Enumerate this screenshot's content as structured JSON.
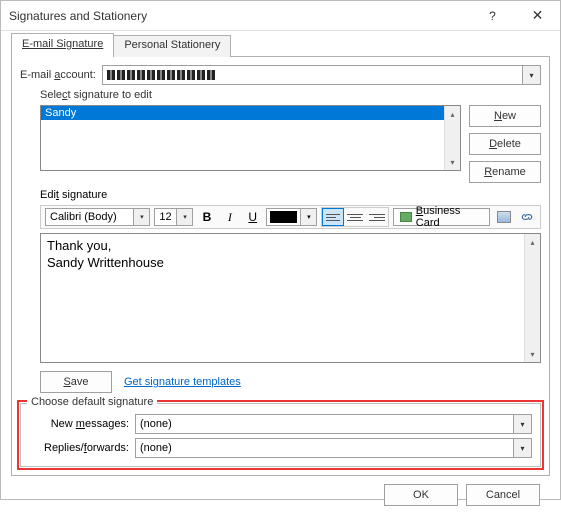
{
  "window": {
    "title": "Signatures and Stationery",
    "help_symbol": "?",
    "close_symbol": "✕"
  },
  "tabs": {
    "email": "E-mail Signature",
    "personal": "Personal Stationery"
  },
  "account": {
    "label_pre": "E-mail ",
    "label_key": "a",
    "label_post": "ccount:",
    "value": ""
  },
  "select_sig": {
    "label_pre": "Sele",
    "label_key": "c",
    "label_post": "t signature to edit",
    "selected": "Sandy"
  },
  "buttons": {
    "new_key": "N",
    "new_post": "ew",
    "delete_key": "D",
    "delete_post": "elete",
    "rename_key": "R",
    "rename_post": "ename",
    "save_key": "S",
    "save_post": "ave"
  },
  "edit": {
    "label_pre": "Edi",
    "label_key": "t",
    "label_post": " signature",
    "font": "Calibri (Body)",
    "size": "12",
    "content": "Thank you,\nSandy Writtenhouse"
  },
  "toolbar": {
    "bold": "B",
    "italic": "I",
    "underline": "U",
    "biz_key": "B",
    "biz_post": "usiness Card"
  },
  "templates_link": "Get signature templates",
  "defaults": {
    "legend": "Choose default signature",
    "newmsg_pre": "New ",
    "newmsg_key": "m",
    "newmsg_post": "essages:",
    "newmsg_value": "(none)",
    "replies_pre": "Replies/",
    "replies_key": "f",
    "replies_post": "orwards:",
    "replies_value": "(none)"
  },
  "footer": {
    "ok": "OK",
    "cancel": "Cancel"
  }
}
